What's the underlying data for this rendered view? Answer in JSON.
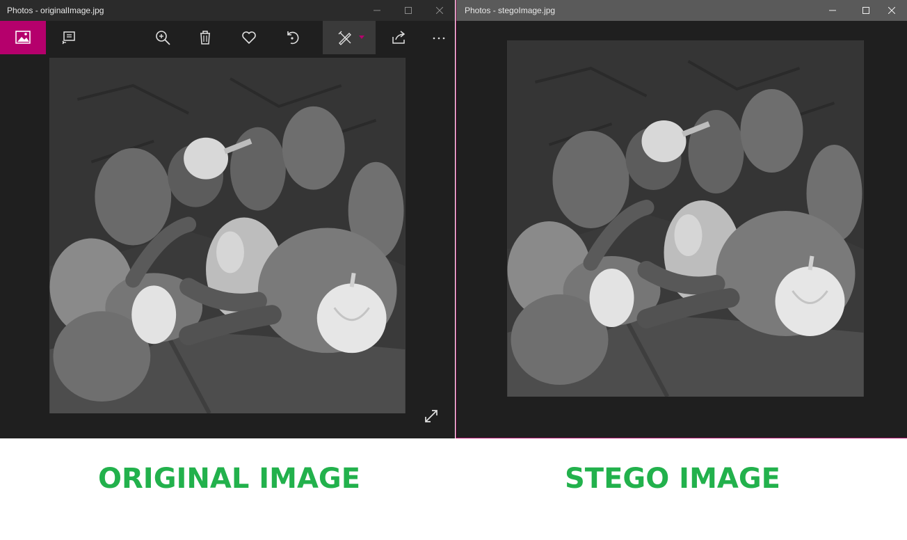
{
  "left_window": {
    "title": "Photos - originalImage.jpg",
    "toolbar": {
      "items": [
        {
          "icon": "photo-icon",
          "active": true
        },
        {
          "icon": "slideshow-icon"
        },
        {
          "icon": "zoom-in-icon"
        },
        {
          "icon": "delete-icon"
        },
        {
          "icon": "heart-icon"
        },
        {
          "icon": "rotate-icon"
        },
        {
          "icon": "edit-draw-icon",
          "dropdown": true
        },
        {
          "icon": "share-icon"
        },
        {
          "icon": "more-icon"
        }
      ],
      "accent": "#b5006c"
    },
    "expand_icon": "expand-icon"
  },
  "right_window": {
    "title": "Photos - stegoImage.jpg",
    "accent_border": "#b0146e"
  },
  "captions": {
    "left": "ORIGINAL IMAGE",
    "right": "STEGO IMAGE",
    "color": "#22b14c"
  }
}
